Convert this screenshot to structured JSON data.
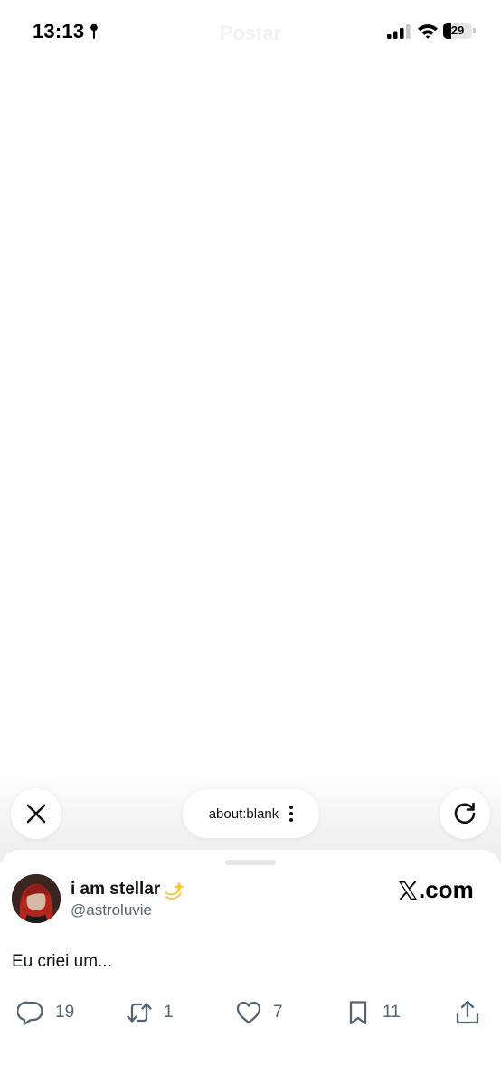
{
  "status_bar": {
    "time": "13:13",
    "battery_level": "29",
    "ghost_title": "Postar",
    "icons": [
      "location-icon",
      "signal-icon",
      "wifi-icon",
      "battery-icon"
    ]
  },
  "browser": {
    "url": "about:blank",
    "close_icon": "close-icon",
    "reload_icon": "reload-icon",
    "more_icon": "more-vertical-icon"
  },
  "post": {
    "display_name": "i am stellar",
    "badge_icon": "shooting-star-icon",
    "handle": "@astroluvie",
    "brand": ".com",
    "text": "Eu criei um...",
    "stats": {
      "replies": "19",
      "reposts": "1",
      "likes": "7",
      "bookmarks": "11"
    },
    "icons": [
      "reply-icon",
      "repost-icon",
      "like-icon",
      "bookmark-icon",
      "share-icon"
    ]
  },
  "colors": {
    "text_primary": "#0f1419",
    "text_secondary": "#536471",
    "background": "#ffffff",
    "fade": "#ededed"
  }
}
